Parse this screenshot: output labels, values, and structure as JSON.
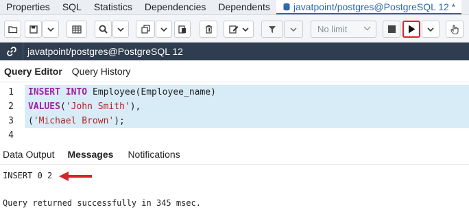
{
  "top_tabs": [
    "Properties",
    "SQL",
    "Statistics",
    "Dependencies",
    "Dependents"
  ],
  "active_tab": "javatpoint/postgres@PostgreSQL 12 *",
  "toolbar": {
    "limit_value": "No limit"
  },
  "connection": {
    "label": "javatpoint/postgres@PostgreSQL 12"
  },
  "editor_tabs": [
    "Query Editor",
    "Query History"
  ],
  "editor_lines": {
    "n1": "1",
    "n2": "2",
    "n3": "3",
    "n4": "4",
    "l1_kw1": "INSERT",
    "l1_kw2": "INTO",
    "l1_rest": "Employee(Employee_name)",
    "l2_kw": "VALUES",
    "l2_open": "(",
    "l2_str": "'John Smith'",
    "l2_close": "),",
    "l3_open": "(",
    "l3_str": "'Michael Brown'",
    "l3_close": ");"
  },
  "output_tabs": [
    "Data Output",
    "Messages",
    "Notifications"
  ],
  "messages": {
    "result": "INSERT 0 2",
    "status": "Query returned successfully in 345 msec."
  },
  "colors": {
    "accent": "#2c65b0",
    "connection_bar": "#2e3d4f",
    "selection": "#d8ecf8",
    "keyword": "#a01fa6",
    "string": "#b22222",
    "highlight": "#d8232a"
  }
}
